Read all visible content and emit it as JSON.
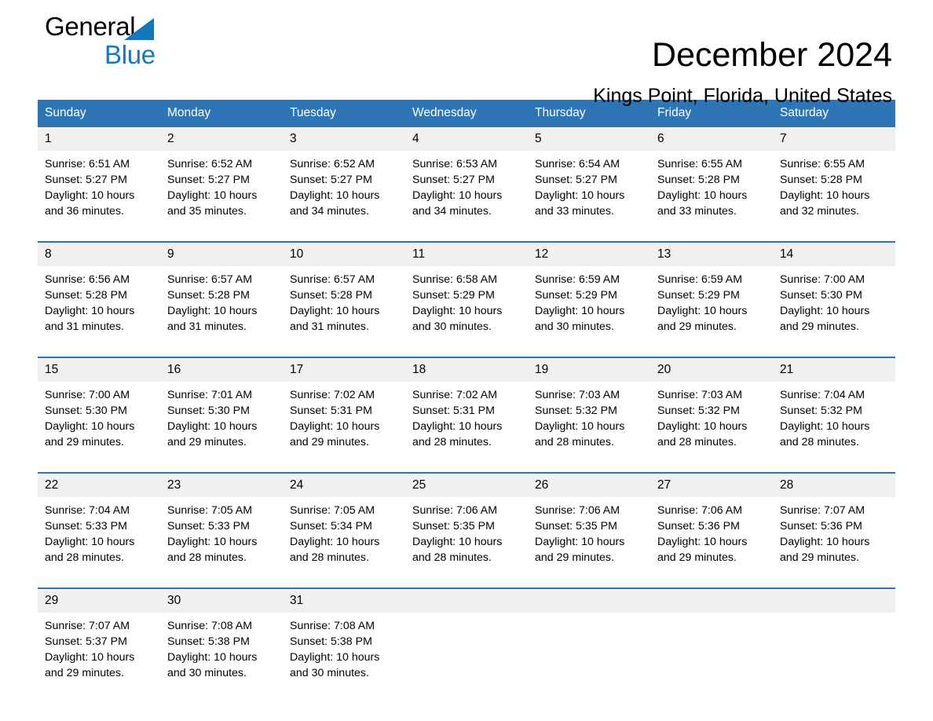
{
  "brand": {
    "name_part1": "General",
    "name_part2": "Blue",
    "accent_color": "#1378be",
    "triangle_icon": "triangle-icon"
  },
  "header": {
    "title": "December 2024",
    "subtitle": "Kings Point, Florida, United States"
  },
  "theme": {
    "header_blue": "#2e75b6",
    "daynum_bg": "#f0f0f0",
    "text": "#000000"
  },
  "calendar": {
    "weekday_headers": [
      "Sunday",
      "Monday",
      "Tuesday",
      "Wednesday",
      "Thursday",
      "Friday",
      "Saturday"
    ],
    "labels": {
      "sunrise_prefix": "Sunrise:",
      "sunset_prefix": "Sunset:",
      "daylight_prefix": "Daylight:"
    },
    "weeks": [
      [
        {
          "day": "1",
          "sunrise": "Sunrise: 6:51 AM",
          "sunset": "Sunset: 5:27 PM",
          "daylight_line1": "Daylight: 10 hours",
          "daylight_line2": "and 36 minutes."
        },
        {
          "day": "2",
          "sunrise": "Sunrise: 6:52 AM",
          "sunset": "Sunset: 5:27 PM",
          "daylight_line1": "Daylight: 10 hours",
          "daylight_line2": "and 35 minutes."
        },
        {
          "day": "3",
          "sunrise": "Sunrise: 6:52 AM",
          "sunset": "Sunset: 5:27 PM",
          "daylight_line1": "Daylight: 10 hours",
          "daylight_line2": "and 34 minutes."
        },
        {
          "day": "4",
          "sunrise": "Sunrise: 6:53 AM",
          "sunset": "Sunset: 5:27 PM",
          "daylight_line1": "Daylight: 10 hours",
          "daylight_line2": "and 34 minutes."
        },
        {
          "day": "5",
          "sunrise": "Sunrise: 6:54 AM",
          "sunset": "Sunset: 5:27 PM",
          "daylight_line1": "Daylight: 10 hours",
          "daylight_line2": "and 33 minutes."
        },
        {
          "day": "6",
          "sunrise": "Sunrise: 6:55 AM",
          "sunset": "Sunset: 5:28 PM",
          "daylight_line1": "Daylight: 10 hours",
          "daylight_line2": "and 33 minutes."
        },
        {
          "day": "7",
          "sunrise": "Sunrise: 6:55 AM",
          "sunset": "Sunset: 5:28 PM",
          "daylight_line1": "Daylight: 10 hours",
          "daylight_line2": "and 32 minutes."
        }
      ],
      [
        {
          "day": "8",
          "sunrise": "Sunrise: 6:56 AM",
          "sunset": "Sunset: 5:28 PM",
          "daylight_line1": "Daylight: 10 hours",
          "daylight_line2": "and 31 minutes."
        },
        {
          "day": "9",
          "sunrise": "Sunrise: 6:57 AM",
          "sunset": "Sunset: 5:28 PM",
          "daylight_line1": "Daylight: 10 hours",
          "daylight_line2": "and 31 minutes."
        },
        {
          "day": "10",
          "sunrise": "Sunrise: 6:57 AM",
          "sunset": "Sunset: 5:28 PM",
          "daylight_line1": "Daylight: 10 hours",
          "daylight_line2": "and 31 minutes."
        },
        {
          "day": "11",
          "sunrise": "Sunrise: 6:58 AM",
          "sunset": "Sunset: 5:29 PM",
          "daylight_line1": "Daylight: 10 hours",
          "daylight_line2": "and 30 minutes."
        },
        {
          "day": "12",
          "sunrise": "Sunrise: 6:59 AM",
          "sunset": "Sunset: 5:29 PM",
          "daylight_line1": "Daylight: 10 hours",
          "daylight_line2": "and 30 minutes."
        },
        {
          "day": "13",
          "sunrise": "Sunrise: 6:59 AM",
          "sunset": "Sunset: 5:29 PM",
          "daylight_line1": "Daylight: 10 hours",
          "daylight_line2": "and 29 minutes."
        },
        {
          "day": "14",
          "sunrise": "Sunrise: 7:00 AM",
          "sunset": "Sunset: 5:30 PM",
          "daylight_line1": "Daylight: 10 hours",
          "daylight_line2": "and 29 minutes."
        }
      ],
      [
        {
          "day": "15",
          "sunrise": "Sunrise: 7:00 AM",
          "sunset": "Sunset: 5:30 PM",
          "daylight_line1": "Daylight: 10 hours",
          "daylight_line2": "and 29 minutes."
        },
        {
          "day": "16",
          "sunrise": "Sunrise: 7:01 AM",
          "sunset": "Sunset: 5:30 PM",
          "daylight_line1": "Daylight: 10 hours",
          "daylight_line2": "and 29 minutes."
        },
        {
          "day": "17",
          "sunrise": "Sunrise: 7:02 AM",
          "sunset": "Sunset: 5:31 PM",
          "daylight_line1": "Daylight: 10 hours",
          "daylight_line2": "and 29 minutes."
        },
        {
          "day": "18",
          "sunrise": "Sunrise: 7:02 AM",
          "sunset": "Sunset: 5:31 PM",
          "daylight_line1": "Daylight: 10 hours",
          "daylight_line2": "and 28 minutes."
        },
        {
          "day": "19",
          "sunrise": "Sunrise: 7:03 AM",
          "sunset": "Sunset: 5:32 PM",
          "daylight_line1": "Daylight: 10 hours",
          "daylight_line2": "and 28 minutes."
        },
        {
          "day": "20",
          "sunrise": "Sunrise: 7:03 AM",
          "sunset": "Sunset: 5:32 PM",
          "daylight_line1": "Daylight: 10 hours",
          "daylight_line2": "and 28 minutes."
        },
        {
          "day": "21",
          "sunrise": "Sunrise: 7:04 AM",
          "sunset": "Sunset: 5:32 PM",
          "daylight_line1": "Daylight: 10 hours",
          "daylight_line2": "and 28 minutes."
        }
      ],
      [
        {
          "day": "22",
          "sunrise": "Sunrise: 7:04 AM",
          "sunset": "Sunset: 5:33 PM",
          "daylight_line1": "Daylight: 10 hours",
          "daylight_line2": "and 28 minutes."
        },
        {
          "day": "23",
          "sunrise": "Sunrise: 7:05 AM",
          "sunset": "Sunset: 5:33 PM",
          "daylight_line1": "Daylight: 10 hours",
          "daylight_line2": "and 28 minutes."
        },
        {
          "day": "24",
          "sunrise": "Sunrise: 7:05 AM",
          "sunset": "Sunset: 5:34 PM",
          "daylight_line1": "Daylight: 10 hours",
          "daylight_line2": "and 28 minutes."
        },
        {
          "day": "25",
          "sunrise": "Sunrise: 7:06 AM",
          "sunset": "Sunset: 5:35 PM",
          "daylight_line1": "Daylight: 10 hours",
          "daylight_line2": "and 28 minutes."
        },
        {
          "day": "26",
          "sunrise": "Sunrise: 7:06 AM",
          "sunset": "Sunset: 5:35 PM",
          "daylight_line1": "Daylight: 10 hours",
          "daylight_line2": "and 29 minutes."
        },
        {
          "day": "27",
          "sunrise": "Sunrise: 7:06 AM",
          "sunset": "Sunset: 5:36 PM",
          "daylight_line1": "Daylight: 10 hours",
          "daylight_line2": "and 29 minutes."
        },
        {
          "day": "28",
          "sunrise": "Sunrise: 7:07 AM",
          "sunset": "Sunset: 5:36 PM",
          "daylight_line1": "Daylight: 10 hours",
          "daylight_line2": "and 29 minutes."
        }
      ],
      [
        {
          "day": "29",
          "sunrise": "Sunrise: 7:07 AM",
          "sunset": "Sunset: 5:37 PM",
          "daylight_line1": "Daylight: 10 hours",
          "daylight_line2": "and 29 minutes."
        },
        {
          "day": "30",
          "sunrise": "Sunrise: 7:08 AM",
          "sunset": "Sunset: 5:38 PM",
          "daylight_line1": "Daylight: 10 hours",
          "daylight_line2": "and 30 minutes."
        },
        {
          "day": "31",
          "sunrise": "Sunrise: 7:08 AM",
          "sunset": "Sunset: 5:38 PM",
          "daylight_line1": "Daylight: 10 hours",
          "daylight_line2": "and 30 minutes."
        },
        {
          "day": "",
          "sunrise": "",
          "sunset": "",
          "daylight_line1": "",
          "daylight_line2": ""
        },
        {
          "day": "",
          "sunrise": "",
          "sunset": "",
          "daylight_line1": "",
          "daylight_line2": ""
        },
        {
          "day": "",
          "sunrise": "",
          "sunset": "",
          "daylight_line1": "",
          "daylight_line2": ""
        },
        {
          "day": "",
          "sunrise": "",
          "sunset": "",
          "daylight_line1": "",
          "daylight_line2": ""
        }
      ]
    ]
  }
}
